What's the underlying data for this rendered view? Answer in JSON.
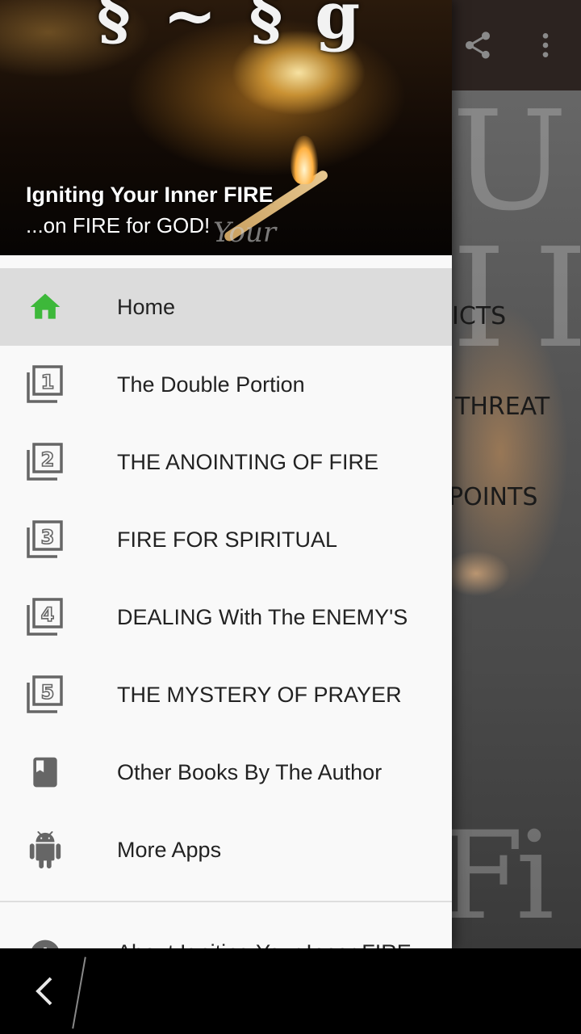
{
  "app": {
    "list_items": [
      "ICTS",
      "THREAT",
      "POINTS"
    ],
    "toolbar_icons": [
      "share-icon",
      "overflow-menu-icon"
    ]
  },
  "drawer": {
    "header": {
      "title": "Igniting Your Inner FIRE",
      "subtitle": "...on FIRE for GOD!"
    },
    "items": [
      {
        "label": "Home",
        "icon": "home-icon",
        "selected": true
      },
      {
        "label": "The Double Portion",
        "icon": "filter-1-icon",
        "selected": false
      },
      {
        "label": "THE ANOINTING OF FIRE",
        "icon": "filter-2-icon",
        "selected": false
      },
      {
        "label": "FIRE FOR SPIRITUAL",
        "icon": "filter-3-icon",
        "selected": false
      },
      {
        "label": "DEALING With The ENEMY'S",
        "icon": "filter-4-icon",
        "selected": false
      },
      {
        "label": "THE MYSTERY OF PRAYER",
        "icon": "filter-5-icon",
        "selected": false
      },
      {
        "label": "Other Books By The Author",
        "icon": "book-icon",
        "selected": false
      },
      {
        "label": "More Apps",
        "icon": "android-icon",
        "selected": false
      }
    ],
    "partial_item": {
      "label": "About Igniting Your Inner FIRE",
      "icon": "info-icon"
    }
  },
  "colors": {
    "home_icon": "#3db83a",
    "drawer_bg": "#f9f9f9",
    "selected_bg": "#dcdcdc",
    "toolbar": "#2c2320"
  }
}
